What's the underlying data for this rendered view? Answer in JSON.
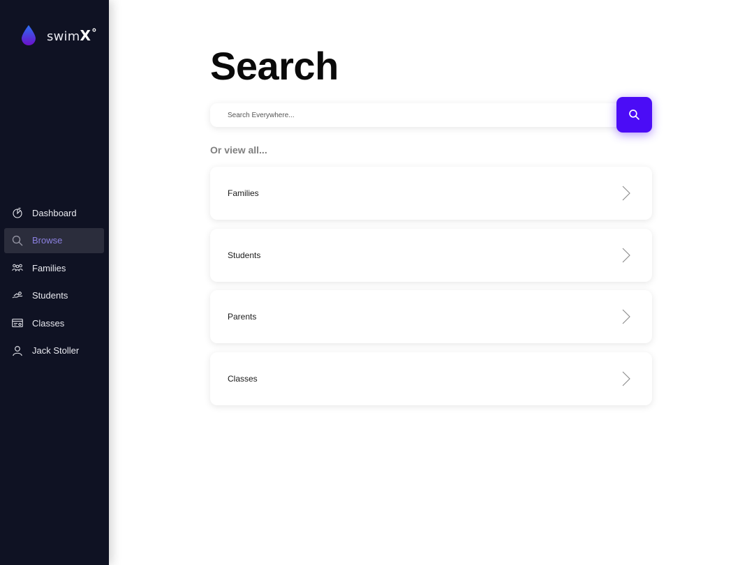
{
  "brand": {
    "name": "swim",
    "mark": "X",
    "degree": "°"
  },
  "sidebar": {
    "items": [
      {
        "label": "Dashboard",
        "icon": "dashboard-icon",
        "active": false
      },
      {
        "label": "Browse",
        "icon": "search-icon",
        "active": true
      },
      {
        "label": "Families",
        "icon": "families-icon",
        "active": false
      },
      {
        "label": "Students",
        "icon": "students-icon",
        "active": false
      },
      {
        "label": "Classes",
        "icon": "classes-icon",
        "active": false
      },
      {
        "label": "Jack Stoller",
        "icon": "user-icon",
        "active": false
      }
    ]
  },
  "main": {
    "title": "Search",
    "search": {
      "placeholder": "Search Everywhere...",
      "value": ""
    },
    "view_all_label": "Or view all...",
    "cards": [
      {
        "label": "Families"
      },
      {
        "label": "Students"
      },
      {
        "label": "Parents"
      },
      {
        "label": "Classes"
      }
    ]
  },
  "colors": {
    "sidebar_bg": "#0f1223",
    "accent": "#4b0cf6",
    "active_item_bg": "#2b2d3c",
    "active_item_text": "#8b80e0"
  }
}
